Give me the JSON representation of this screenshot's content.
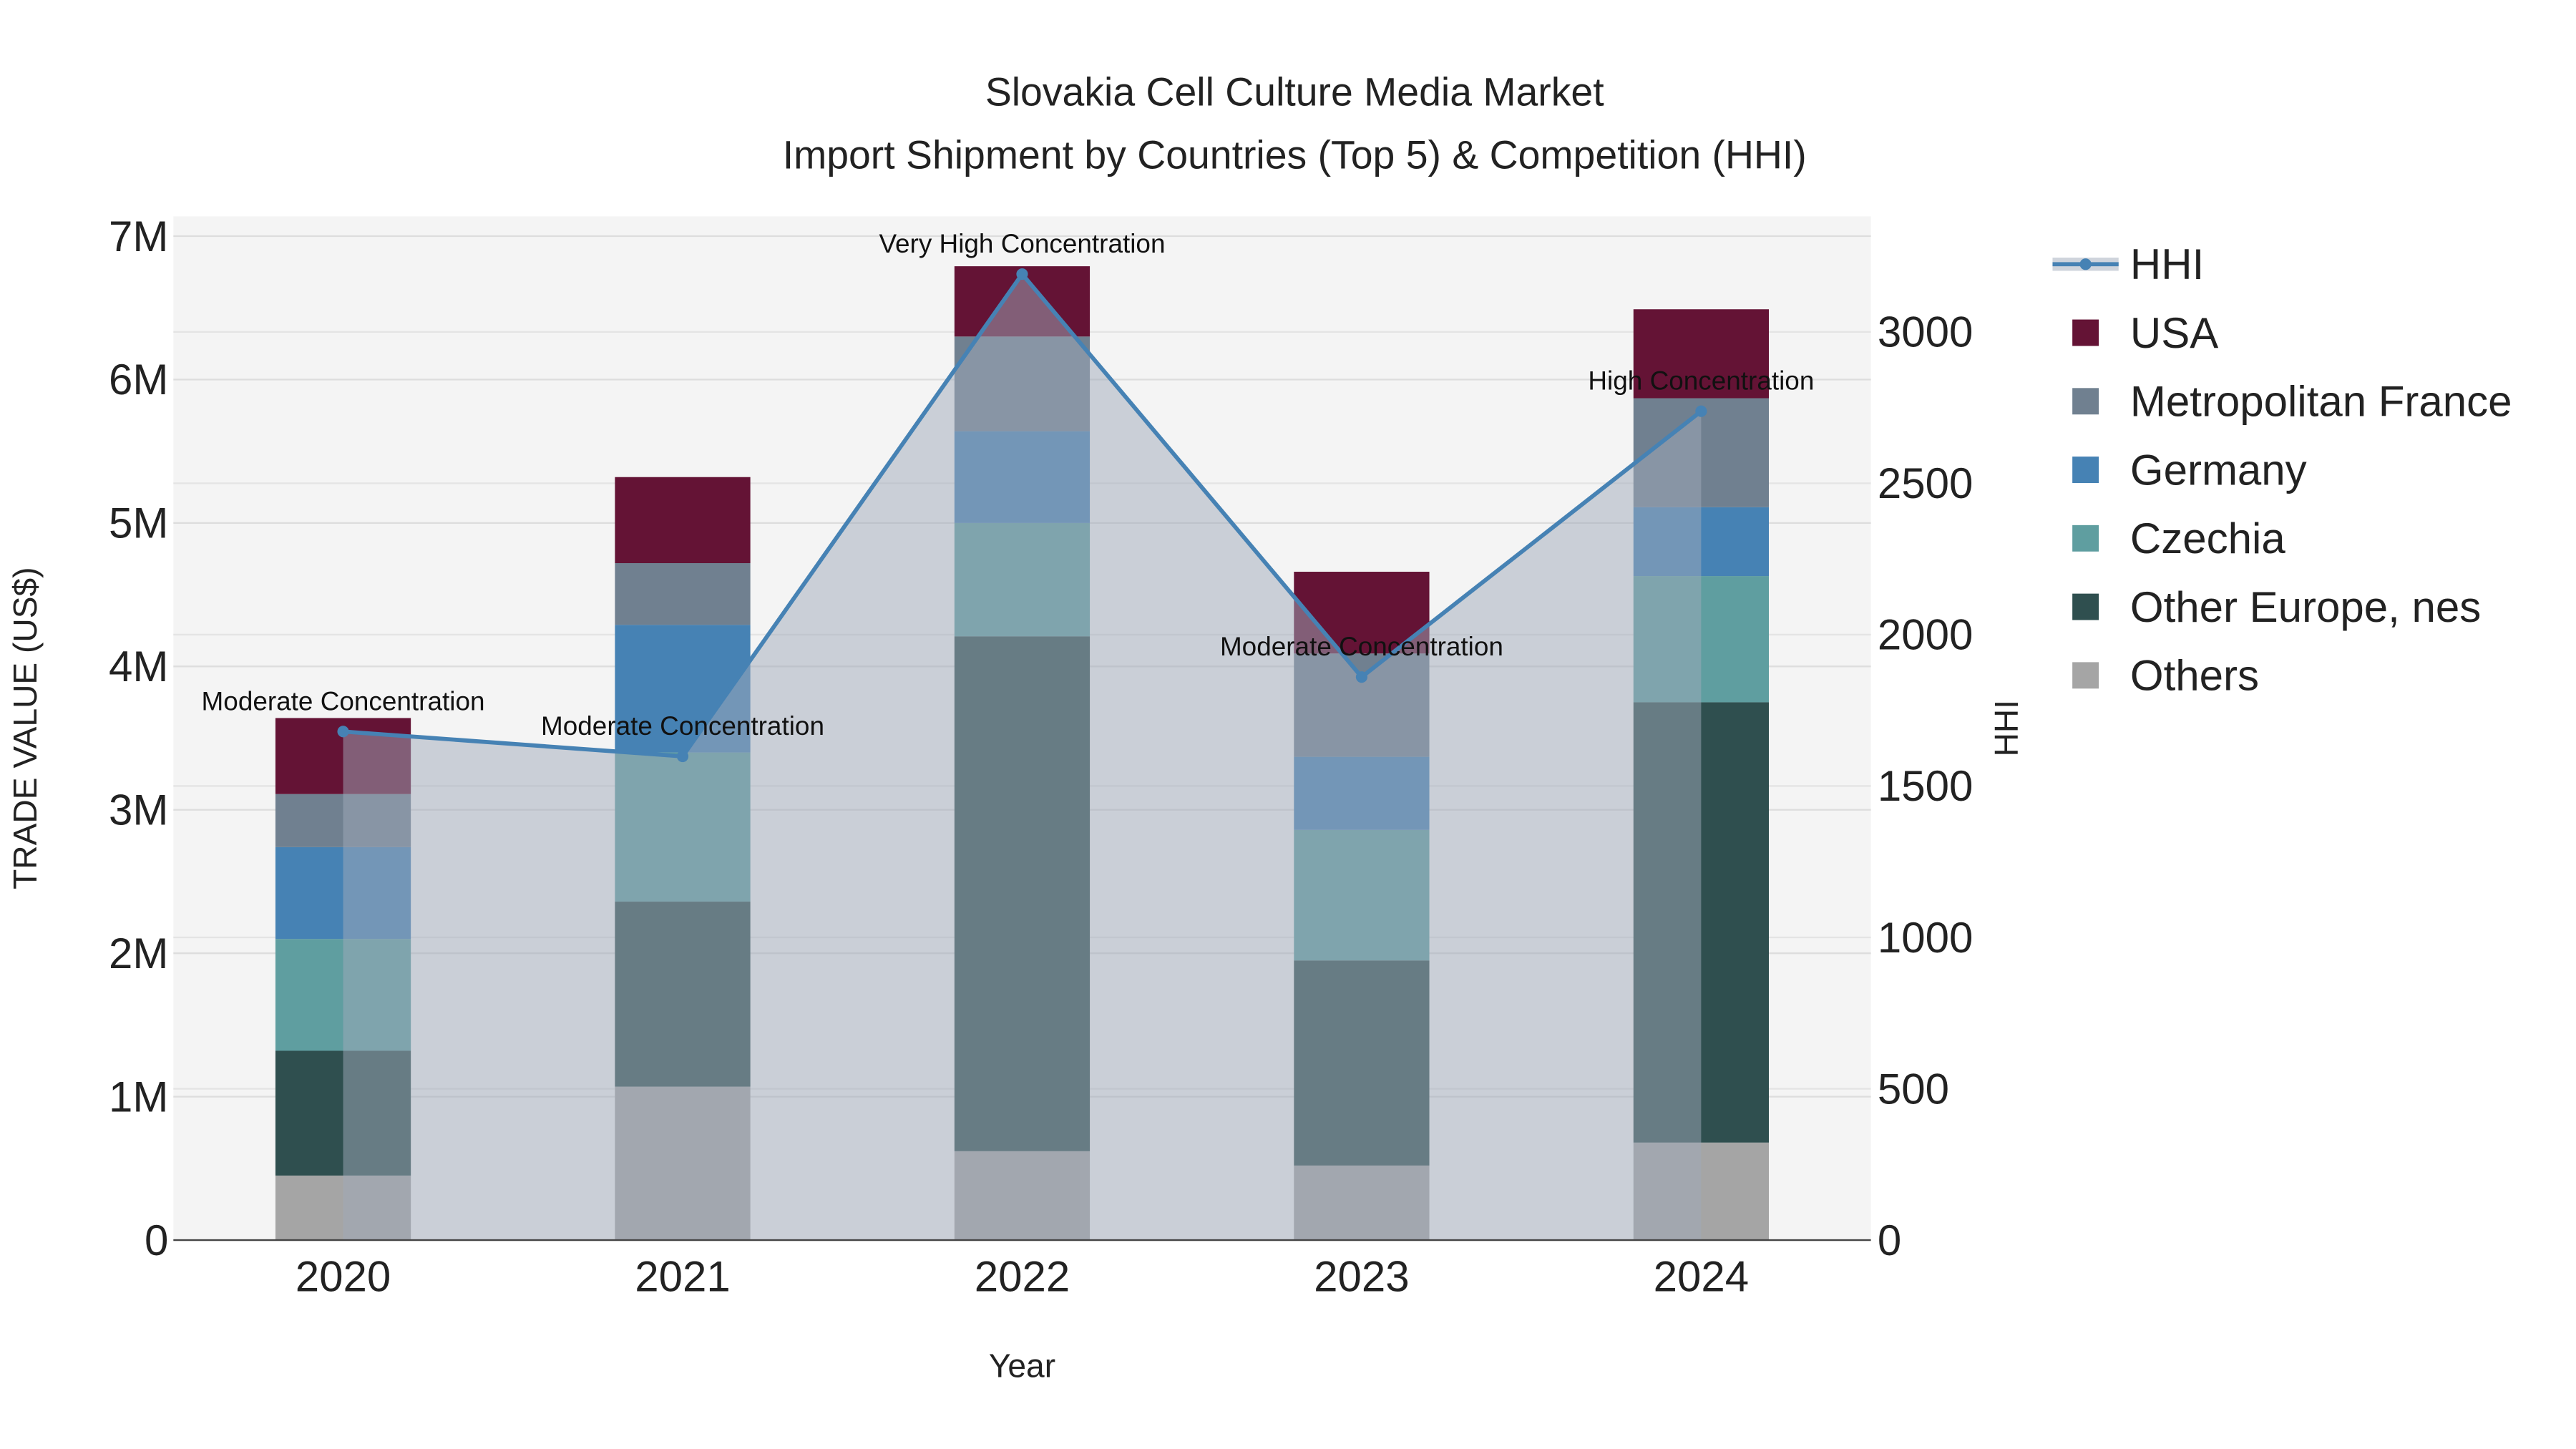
{
  "chart_data": {
    "type": "bar",
    "stacked": true,
    "title": "Slovakia Cell Culture Media Market",
    "subtitle": "Import Shipment by Countries (Top 5) & Competition (HHI)",
    "xlabel": "Year",
    "ylabel": "TRADE VALUE (US$)",
    "y2label": "HHI",
    "categories": [
      "2020",
      "2021",
      "2022",
      "2023",
      "2024"
    ],
    "ylim": [
      0,
      7200000
    ],
    "y2lim": [
      0,
      3380
    ],
    "yticks": [
      {
        "v": 0,
        "label": "0"
      },
      {
        "v": 1000000,
        "label": "1M"
      },
      {
        "v": 2000000,
        "label": "2M"
      },
      {
        "v": 3000000,
        "label": "3M"
      },
      {
        "v": 4000000,
        "label": "4M"
      },
      {
        "v": 5000000,
        "label": "5M"
      },
      {
        "v": 6000000,
        "label": "6M"
      },
      {
        "v": 7000000,
        "label": "7M"
      }
    ],
    "y2ticks": [
      {
        "v": 0,
        "label": "0"
      },
      {
        "v": 500,
        "label": "500"
      },
      {
        "v": 1000,
        "label": "1000"
      },
      {
        "v": 1500,
        "label": "1500"
      },
      {
        "v": 2000,
        "label": "2000"
      },
      {
        "v": 2500,
        "label": "2500"
      },
      {
        "v": 3000,
        "label": "3000"
      }
    ],
    "series": [
      {
        "name": "Others",
        "color": "#a5a5a5",
        "values": [
          450000,
          1070000,
          620000,
          520000,
          680000
        ]
      },
      {
        "name": "Other Europe, nes",
        "color": "#2f4f4f",
        "values": [
          870000,
          1290000,
          3590000,
          1430000,
          3070000
        ]
      },
      {
        "name": "Czechia",
        "color": "#5f9ea0",
        "values": [
          780000,
          1040000,
          790000,
          910000,
          880000
        ]
      },
      {
        "name": "Germany",
        "color": "#4682b4",
        "values": [
          640000,
          890000,
          640000,
          510000,
          480000
        ]
      },
      {
        "name": "Metropolitan France",
        "color": "#708090",
        "values": [
          370000,
          430000,
          660000,
          720000,
          760000
        ]
      },
      {
        "name": "USA",
        "color": "#641335",
        "values": [
          530000,
          600000,
          490000,
          570000,
          620000
        ]
      }
    ],
    "hhi": {
      "name": "HHI",
      "color": "#4682b4",
      "values": [
        1680,
        1598,
        3191,
        1860,
        2738
      ],
      "annotations": [
        "Moderate Concentration",
        "Moderate Concentration",
        "Very High Concentration",
        "Moderate Concentration",
        "High Concentration"
      ]
    },
    "legend_position": "right",
    "legend_order": [
      "HHI",
      "USA",
      "Metropolitan France",
      "Germany",
      "Czechia",
      "Other Europe, nes",
      "Others"
    ],
    "grid": true
  }
}
